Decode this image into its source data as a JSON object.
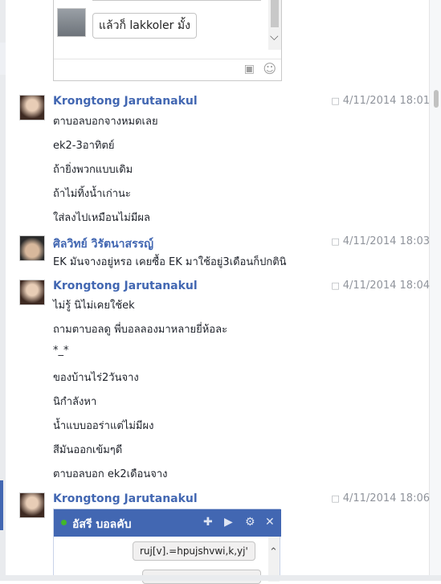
{
  "previous_chat": {
    "bubble_text": "แล้วก็ lakkoler มั้ง",
    "camera_icon": "camera-icon",
    "emoji_icon": "smile-icon"
  },
  "messages": [
    {
      "sender": "Krongtong Jarutanakul",
      "timestamp": "4/11/2014 18:01",
      "lines": [
        "ตาบอลบอกจางหมดเลย",
        "ek2-3อาทิตย์",
        "ถ้ายิ่งพวกแบบเดิม",
        "ถ้าไม่ทิ้งน้ำเก่านะ",
        "ใส่ลงไปเหมือนไม่มีผล"
      ]
    },
    {
      "sender": "ศิลวิทย์ วิรัตนาสรรญ์",
      "timestamp": "4/11/2014 18:03",
      "lines": [
        "EK มันจางอยู่หรอ เคยซื้อ EK มาใช้อยู่3เดือนก็ปกตินิ"
      ]
    },
    {
      "sender": "Krongtong Jarutanakul",
      "timestamp": "4/11/2014 18:04",
      "lines": [
        "ไม่รู้ นิไม่เคยใช้ek",
        "ถามตาบอลดู พี่บอลลองมาหลายยี่ห้อละ",
        "*_*",
        "ของบ้านไร่2วันจาง",
        "นิกำลังหา",
        "น้ำแบบออร่าแต่ไม่มีผง",
        "สีมันออกเข้มๆดี",
        "ตาบอลบอก ek2เดือนจาง"
      ]
    },
    {
      "sender": "Krongtong Jarutanakul",
      "timestamp": "4/11/2014 18:06",
      "lines": []
    }
  ],
  "chat_popup": {
    "title": "อัสรี บอลคับ",
    "bubble_text": "ruj[v].=hpujshvwi,k,yj'",
    "icons": [
      "add-friend-icon",
      "video-call-icon",
      "settings-gear-icon",
      "close-icon"
    ]
  }
}
